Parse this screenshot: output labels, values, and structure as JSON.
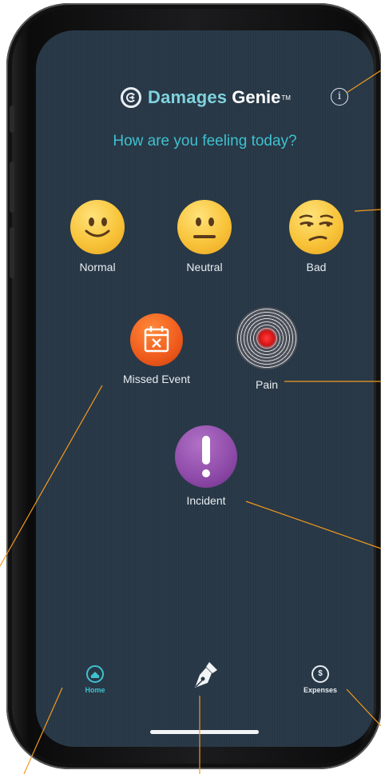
{
  "app": {
    "brand_part1": "Damages",
    "brand_part2": "Genie",
    "brand_tm": "TM",
    "info_symbol": "i"
  },
  "question": "How are you feeling today?",
  "moods": [
    {
      "label": "Normal",
      "icon": "slightly-smiling-face-icon"
    },
    {
      "label": "Neutral",
      "icon": "neutral-face-icon"
    },
    {
      "label": "Bad",
      "icon": "unamused-face-icon"
    }
  ],
  "events": [
    {
      "label": "Missed Event",
      "icon": "calendar-x-icon"
    },
    {
      "label": "Pain",
      "icon": "pain-target-icon"
    },
    {
      "label": "Incident",
      "icon": "exclamation-icon"
    }
  ],
  "tabs": [
    {
      "label": "Home",
      "icon": "home-icon",
      "active": true
    },
    {
      "label": "",
      "icon": "pen-nib-icon",
      "active": false
    },
    {
      "label": "Expenses",
      "icon": "dollar-icon",
      "active": false
    }
  ],
  "colors": {
    "screen_bg": "#273746",
    "accent": "#3fc1cf",
    "callout_line": "#f39a1e"
  }
}
